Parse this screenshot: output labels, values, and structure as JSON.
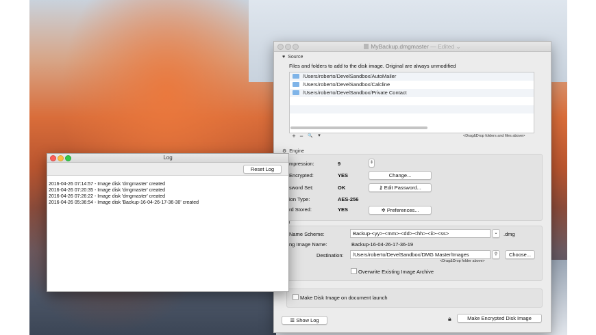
{
  "main_window": {
    "title": "MyBackup.dmgmaster",
    "title_suffix": "— Edited ⌄",
    "source": {
      "header": "Source",
      "description": "Files and folders to add to the disk image. Original are always unmodified",
      "items": [
        "/Users/roberto/DevelSandbox/AutoMailer",
        "/Users/roberto/DevelSandbox/Calcline",
        "/Users/roberto/DevelSandbox/Private Contact"
      ],
      "toolbar": {
        "add": "+",
        "remove": "−",
        "search": "🔍",
        "menu": "▾"
      },
      "drop_hint": "<Drag&Drop folders and files above>"
    },
    "engine": {
      "header": "Engine",
      "compression_label": "mpression:",
      "compression_value": "9",
      "encrypted_label": "Encrypted:",
      "encrypted_value": "YES",
      "change_button": "Change...",
      "password_label": "sword Set:",
      "password_value": "OK",
      "edit_password_button": "Edit Password...",
      "encryption_type_label": "ion Type:",
      "encryption_type_value": "AES-256",
      "stored_label": "rd  Stored:",
      "stored_value": "YES",
      "preferences_button": "Preferences..."
    },
    "destination": {
      "header": "tion",
      "name_scheme_label": "Name Scheme:",
      "name_scheme_value": "Backup-<yy>-<mm>-<dd>-<hh>-<ii>-<ss>",
      "extension": ".dmg",
      "image_name_label": "ng Image Name:",
      "image_name_value": "Backup-16-04-26-17-36-19",
      "destination_label": "Destination:",
      "destination_value": "/Users/roberto/DevelSandbox/DMG Master/Images",
      "choose_button": "Choose...",
      "drop_hint": "<Drag&Drop folder above>",
      "overwrite_label": "Overwrite Existing Image Archive"
    },
    "advanced": {
      "header": "ed",
      "launch_label": "Make Disk Image on document launch"
    },
    "footer": {
      "show_log_button": "Show Log",
      "make_button": "Make Encrypted Disk Image"
    }
  },
  "log_window": {
    "title": "Log",
    "reset_button": "Reset Log",
    "lines": [
      "2016-04-26 07:14:57 - Image disk 'dmgmaster' created",
      "2016-04-26 07:20:35 - Image disk 'dmgmaster' created",
      "2016-04-26 07:26:22 - Image disk 'dmgmaster' created",
      "2016-04-26 05:36:54 - Image disk 'Backup-16-04-26-17-36-30' created"
    ]
  },
  "colors": {
    "close": "#fc605b",
    "minimize": "#fdbc40",
    "zoom": "#34c84a",
    "folder": "#7fb4e8"
  }
}
